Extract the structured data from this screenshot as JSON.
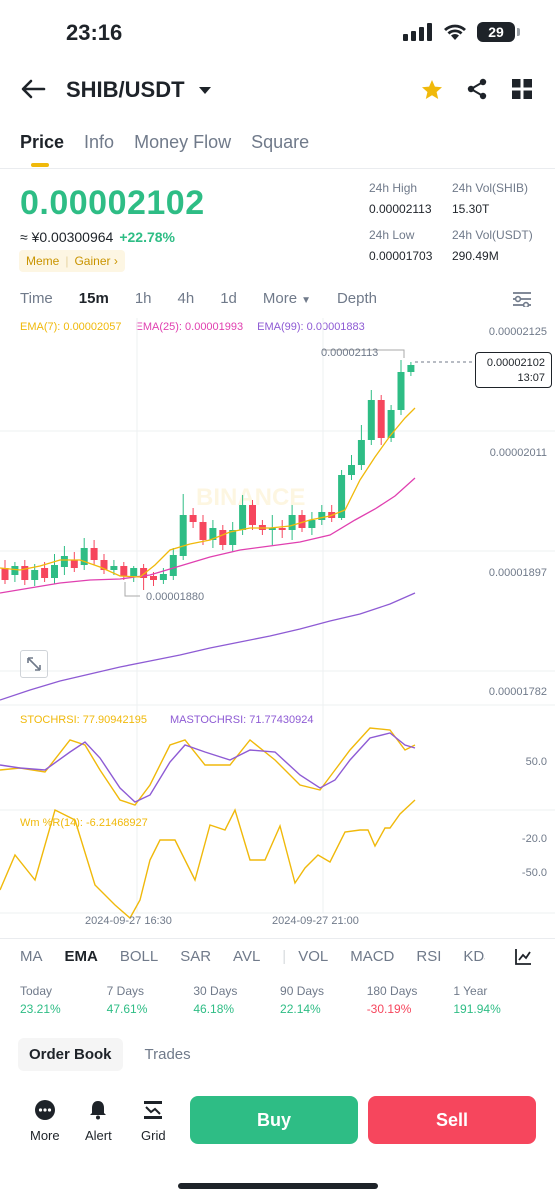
{
  "status": {
    "time": "23:16",
    "battery": "29"
  },
  "header": {
    "pair": "SHIB/USDT"
  },
  "tabs": [
    "Price",
    "Info",
    "Money Flow",
    "Square"
  ],
  "price": {
    "last": "0.00002102",
    "fiat": "≈ ¥0.00300964",
    "change": "+22.78%",
    "tag_meme": "Meme",
    "tag_gainer": "Gainer ›",
    "high_label": "24h High",
    "high": "0.00002113",
    "vol_shib_label": "24h Vol(SHIB)",
    "vol_shib": "15.30T",
    "low_label": "24h Low",
    "low": "0.00001703",
    "vol_usdt_label": "24h Vol(USDT)",
    "vol_usdt": "290.49M"
  },
  "timeframes": {
    "time": "Time",
    "m15": "15m",
    "h1": "1h",
    "h4": "4h",
    "d1": "1d",
    "more": "More",
    "depth": "Depth"
  },
  "ema": {
    "ema7": "EMA(7): 0.00002057",
    "ema25": "EMA(25): 0.00001993",
    "ema99": "EMA(99): 0.00001883"
  },
  "axis": {
    "y1": "0.00002125",
    "y2": "0.00002011",
    "y3": "0.00001897",
    "y4": "0.00001782",
    "s50": "50.0",
    "w20": "-20.0",
    "w50": "-50.0"
  },
  "annotations": {
    "high": "0.00002113",
    "low": "0.00001880",
    "current_price": "0.00002102",
    "countdown": "13:07",
    "watermark": "BINANCE"
  },
  "stoch": {
    "label": "STOCHRSI: 77.90942195",
    "ma_label": "MASTOCHRSI: 71.77430924"
  },
  "wr": {
    "label": "Wm %R(14): -6.21468927"
  },
  "dates": [
    "2024-09-27 16:30",
    "2024-09-27 21:00"
  ],
  "indicator_tabs": [
    "MA",
    "EMA",
    "BOLL",
    "SAR",
    "AVL",
    "VOL",
    "MACD",
    "RSI",
    "KDJ"
  ],
  "performance": [
    {
      "label": "Today",
      "value": "23.21%"
    },
    {
      "label": "7 Days",
      "value": "47.61%"
    },
    {
      "label": "30 Days",
      "value": "46.18%"
    },
    {
      "label": "90 Days",
      "value": "22.14%"
    },
    {
      "label": "180 Days",
      "value": "-30.19%"
    },
    {
      "label": "1 Year",
      "value": "191.94%"
    }
  ],
  "orderbook": {
    "order_book": "Order Book",
    "trades": "Trades"
  },
  "actions": {
    "more": "More",
    "alert": "Alert",
    "grid": "Grid",
    "buy": "Buy",
    "sell": "Sell"
  },
  "colors": {
    "up": "#2ebd85",
    "down": "#f6465d",
    "ema7": "#f0b90b",
    "ema25": "#e040b0",
    "ema99": "#8e5bd4",
    "accent": "#f0b90b"
  }
}
